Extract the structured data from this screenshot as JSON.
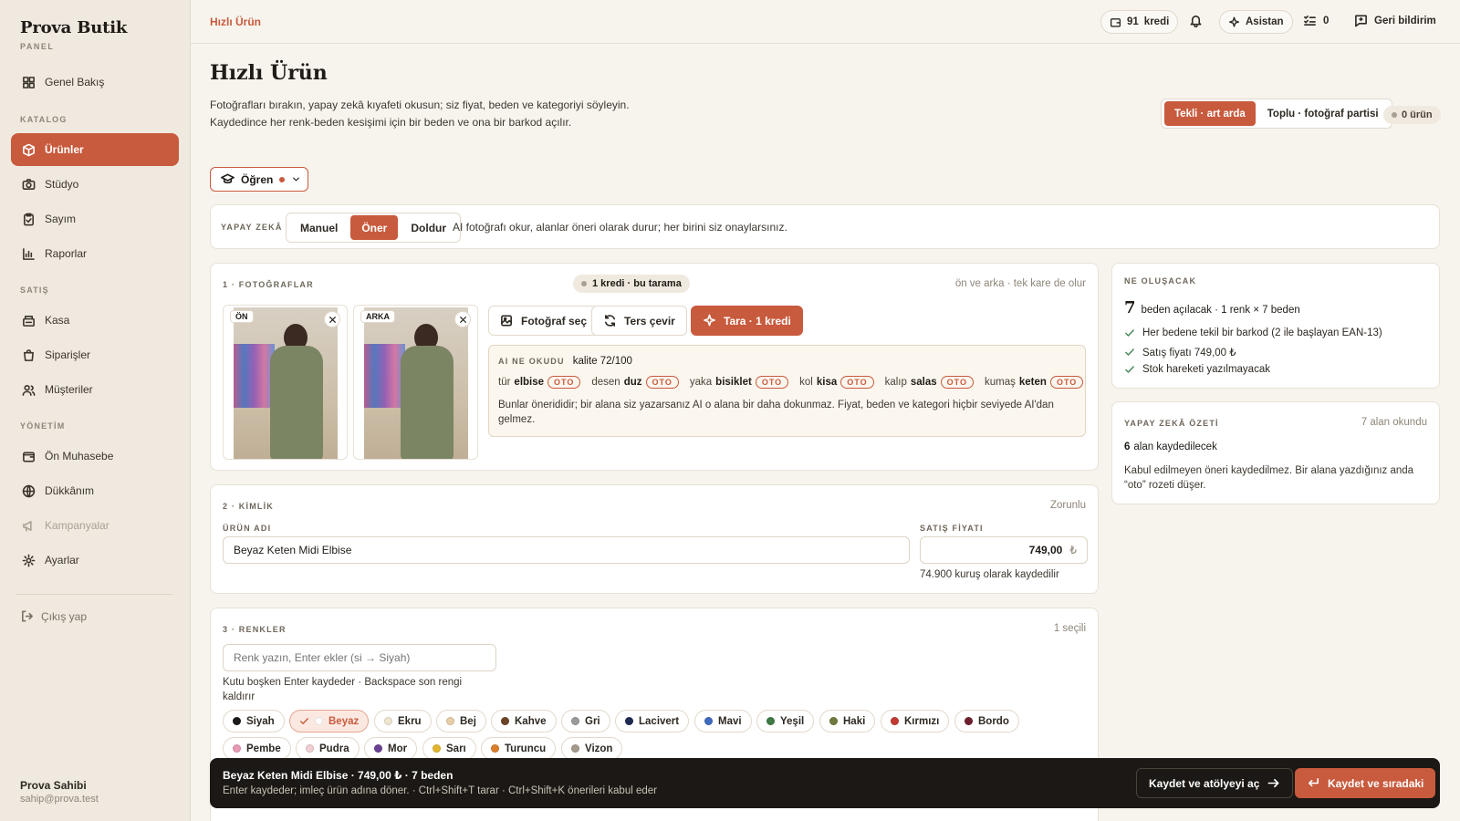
{
  "brand": {
    "name": "Prova Butik",
    "sub": "PANEL"
  },
  "nav": {
    "overview": "Genel Bakış",
    "section_catalog": "KATALOG",
    "products": "Ürünler",
    "studio": "Stüdyo",
    "count": "Sayım",
    "reports": "Raporlar",
    "section_sales": "SATIŞ",
    "register": "Kasa",
    "orders": "Siparişler",
    "customers": "Müşteriler",
    "section_admin": "YÖNETİM",
    "accounting": "Ön Muhasebe",
    "shop": "Dükkânım",
    "campaigns": "Kampanyalar",
    "settings": "Ayarlar",
    "logout": "Çıkış yap"
  },
  "user": {
    "name": "Prova Sahibi",
    "email": "sahip@prova.test"
  },
  "topbar": {
    "breadcrumb": "Hızlı Ürün",
    "credits_value": "91",
    "credits_label": "kredi",
    "assistant": "Asistan",
    "tasks_count": "0",
    "feedback": "Geri bildirim"
  },
  "header": {
    "title": "Hızlı Ürün",
    "lead_line1": "Fotoğrafları bırakın, yapay zekâ kıyafeti okusun; siz fiyat, beden ve kategoriyi söyleyin.",
    "lead_line2": "Kaydedince her renk-beden kesişimi için bir beden ve ona bir barkod açılır.",
    "mode_single": "Tekli · art arda",
    "mode_bulk": "Toplu · fotoğraf partisi",
    "product_count": "0 ürün",
    "learn": "Öğren"
  },
  "ai_mode": {
    "label": "YAPAY ZEKÂ",
    "options": [
      "Manuel",
      "Öner",
      "Doldur"
    ],
    "selected": "Öner",
    "description": "AI fotoğrafı okur, alanlar öneri olarak durur; her birini siz onaylarsınız."
  },
  "photos": {
    "title": "1 · FOTOĞRAFLAR",
    "cost_badge": "1 kredi · bu tarama",
    "hint": "ön ve arka · tek kare de olur",
    "front_tag": "ÖN",
    "back_tag": "ARKA",
    "choose": "Fotoğraf seç",
    "flip": "Ters çevir",
    "scan": "Tara · 1 kredi",
    "ai_read_label": "AI NE OKUDU",
    "quality": "kalite 72/100",
    "oto": "OTO",
    "attributes": [
      {
        "key": "tür",
        "value": "elbise"
      },
      {
        "key": "desen",
        "value": "duz"
      },
      {
        "key": "yaka",
        "value": "bisiklet"
      },
      {
        "key": "kol",
        "value": "kisa"
      },
      {
        "key": "kalıp",
        "value": "salas"
      },
      {
        "key": "kumaş",
        "value": "keten"
      }
    ],
    "note": "Bunlar önerididir; bir alana siz yazarsanız AI o alana bir daha dokunmaz. Fiyat, beden ve kategori hiçbir seviyede AI'dan gelmez."
  },
  "identity": {
    "title": "2 · KİMLİK",
    "required": "Zorunlu",
    "name_label": "ÜRÜN ADI",
    "name_value": "Beyaz Keten Midi Elbise",
    "price_label": "SATIŞ FİYATI",
    "price_value": "749,00",
    "currency": "₺",
    "price_hint": "74.900 kuruş olarak kaydedilir"
  },
  "colors": {
    "title": "3 · RENKLER",
    "selected_count": "1 seçili",
    "placeholder": "Renk yazın, Enter ekler (si → Siyah)",
    "hint": "Kutu boşken Enter kaydeder · Backspace son rengi kaldırır",
    "items": [
      {
        "name": "Siyah",
        "hex": "#1c1a18",
        "selected": false
      },
      {
        "name": "Beyaz",
        "hex": "#ffffff",
        "selected": true
      },
      {
        "name": "Ekru",
        "hex": "#eee6cf",
        "selected": false
      },
      {
        "name": "Bej",
        "hex": "#e8cfa8",
        "selected": false
      },
      {
        "name": "Kahve",
        "hex": "#6e4428",
        "selected": false
      },
      {
        "name": "Gri",
        "hex": "#9a9a9a",
        "selected": false
      },
      {
        "name": "Lacivert",
        "hex": "#1f2a52",
        "selected": false
      },
      {
        "name": "Mavi",
        "hex": "#3f6ac0",
        "selected": false
      },
      {
        "name": "Yeşil",
        "hex": "#3e7a45",
        "selected": false
      },
      {
        "name": "Haki",
        "hex": "#6f7a3e",
        "selected": false
      },
      {
        "name": "Kırmızı",
        "hex": "#c23a32",
        "selected": false
      },
      {
        "name": "Bordo",
        "hex": "#6e1f2e",
        "selected": false
      },
      {
        "name": "Pembe",
        "hex": "#e79ab3",
        "selected": false
      },
      {
        "name": "Pudra",
        "hex": "#f2cfd2",
        "selected": false
      },
      {
        "name": "Mor",
        "hex": "#6b3f93",
        "selected": false
      },
      {
        "name": "Sarı",
        "hex": "#e3b52e",
        "selected": false
      },
      {
        "name": "Turuncu",
        "hex": "#dd7e2a",
        "selected": false
      },
      {
        "name": "Vizon",
        "hex": "#a59a8c",
        "selected": false
      }
    ]
  },
  "summary": {
    "title": "NE OLUŞACAK",
    "big_number": "7",
    "line": "beden açılacak · 1 renk × 7 beden",
    "checks": [
      "Her bedene tekil bir barkod (2 ile başlayan EAN-13)",
      "Satış fiyatı 749,00 ₺",
      "Stok hareketi yazılmayacak"
    ]
  },
  "ai_summary": {
    "title": "YAPAY ZEKÂ ÖZETİ",
    "read_count": "7 alan okundu",
    "save_count": "6",
    "save_label": "alan kaydedilecek",
    "note": "Kabul edilmeyen öneri kaydedilmez. Bir alana yazdığınız anda “oto” rozeti düşer."
  },
  "bottombar": {
    "title": "Beyaz Keten Midi Elbise · 749,00 ₺ · 7 beden",
    "hint": "Enter kaydeder; imleç ürün adına döner. · Ctrl+Shift+T tarar · Ctrl+Shift+K önerileri kabul eder",
    "save_open": "Kaydet ve atölyeyi aç",
    "save_next": "Kaydet ve sıradaki"
  },
  "colors_theme": {
    "accent": "#c85a3d",
    "sidebar": "#efe9df",
    "background": "#f7f4ee",
    "dark": "#1b1815"
  }
}
